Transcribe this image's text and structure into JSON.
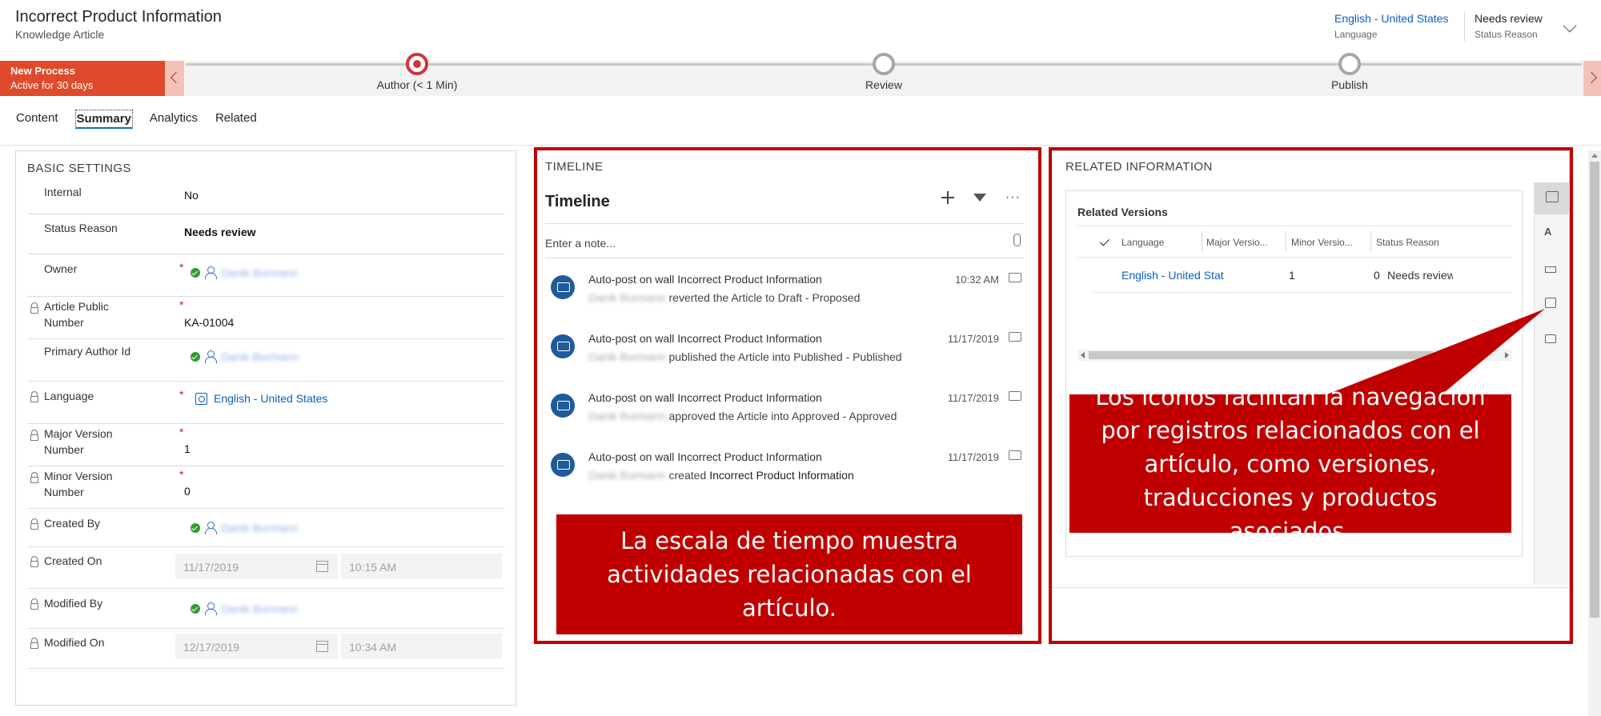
{
  "header": {
    "title": "Incorrect Product Information",
    "subtitle": "Knowledge Article",
    "language_value": "English - United States",
    "language_label": "Language",
    "status_value": "Needs review",
    "status_label": "Status Reason"
  },
  "process": {
    "name": "New Process",
    "duration": "Active for 30 days",
    "stages": [
      {
        "label": "Author  (< 1 Min)",
        "active": true
      },
      {
        "label": "Review",
        "active": false
      },
      {
        "label": "Publish",
        "active": false
      }
    ]
  },
  "tabs": [
    "Content",
    "Summary",
    "Analytics",
    "Related"
  ],
  "selected_tab": "Summary",
  "basic_settings": {
    "title": "BASIC SETTINGS",
    "internal_label": "Internal",
    "internal_value": "No",
    "status_reason_label": "Status Reason",
    "status_reason_value": "Needs review",
    "owner_label": "Owner",
    "owner_value": "Danik Bormann",
    "article_number_label_1": "Article Public",
    "article_number_label_2": "Number",
    "article_number_value": "KA-01004",
    "primary_author_label": "Primary Author Id",
    "primary_author_value": "Danik Bormann",
    "language_label": "Language",
    "language_value": "English - United States",
    "major_label_1": "Major Version",
    "major_label_2": "Number",
    "major_value": "1",
    "minor_label_1": "Minor Version",
    "minor_label_2": "Number",
    "minor_value": "0",
    "created_by_label": "Created By",
    "created_by_value": "Danik Bormann",
    "created_on_label": "Created On",
    "created_on_date": "11/17/2019",
    "created_on_time": "10:15 AM",
    "modified_by_label": "Modified By",
    "modified_by_value": "Danik Bormann",
    "modified_on_label": "Modified On",
    "modified_on_date": "12/17/2019",
    "modified_on_time": "10:34 AM",
    "required_mark": "*"
  },
  "timeline": {
    "section_title": "TIMELINE",
    "heading": "Timeline",
    "note_placeholder": "Enter a note...",
    "more": "···",
    "posts": [
      {
        "title": "Auto-post on wall Incorrect Product Information",
        "user": "Danik Bormann",
        "text": "reverted the Article to Draft - Proposed",
        "date": "10:32 AM"
      },
      {
        "title": "Auto-post on wall Incorrect Product Information",
        "user": "Danik Bormann",
        "text": "published the Article into Published - Published",
        "date": "11/17/2019"
      },
      {
        "title": "Auto-post on wall Incorrect Product Information",
        "user": "Danik Bormann",
        "text": "approved the Article into Approved - Approved",
        "date": "11/17/2019"
      },
      {
        "title": "Auto-post on wall Incorrect Product Information",
        "user": "Danik Bormann",
        "text": "created",
        "text_strong": "Incorrect Product Information",
        "date": "11/17/2019"
      }
    ]
  },
  "related": {
    "section_title": "RELATED INFORMATION",
    "grid_title": "Related Versions",
    "columns": [
      "Language",
      "Major Versio...",
      "Minor Versio...",
      "Status Reason"
    ],
    "row": {
      "language": "English - United States",
      "major": "1",
      "minor": "0",
      "status": "Needs review"
    }
  },
  "callouts": {
    "timeline_note": "La escala de tiempo muestra actividades relacionadas con el artículo.",
    "icons_note": "Los iconos facilitan la navegación por registros relacionados con el artículo, como versiones, traducciones y productos asociados."
  },
  "colors": {
    "highlight": "#c00000",
    "process_flag": "#e04a2b",
    "link": "#0a5fbf"
  }
}
